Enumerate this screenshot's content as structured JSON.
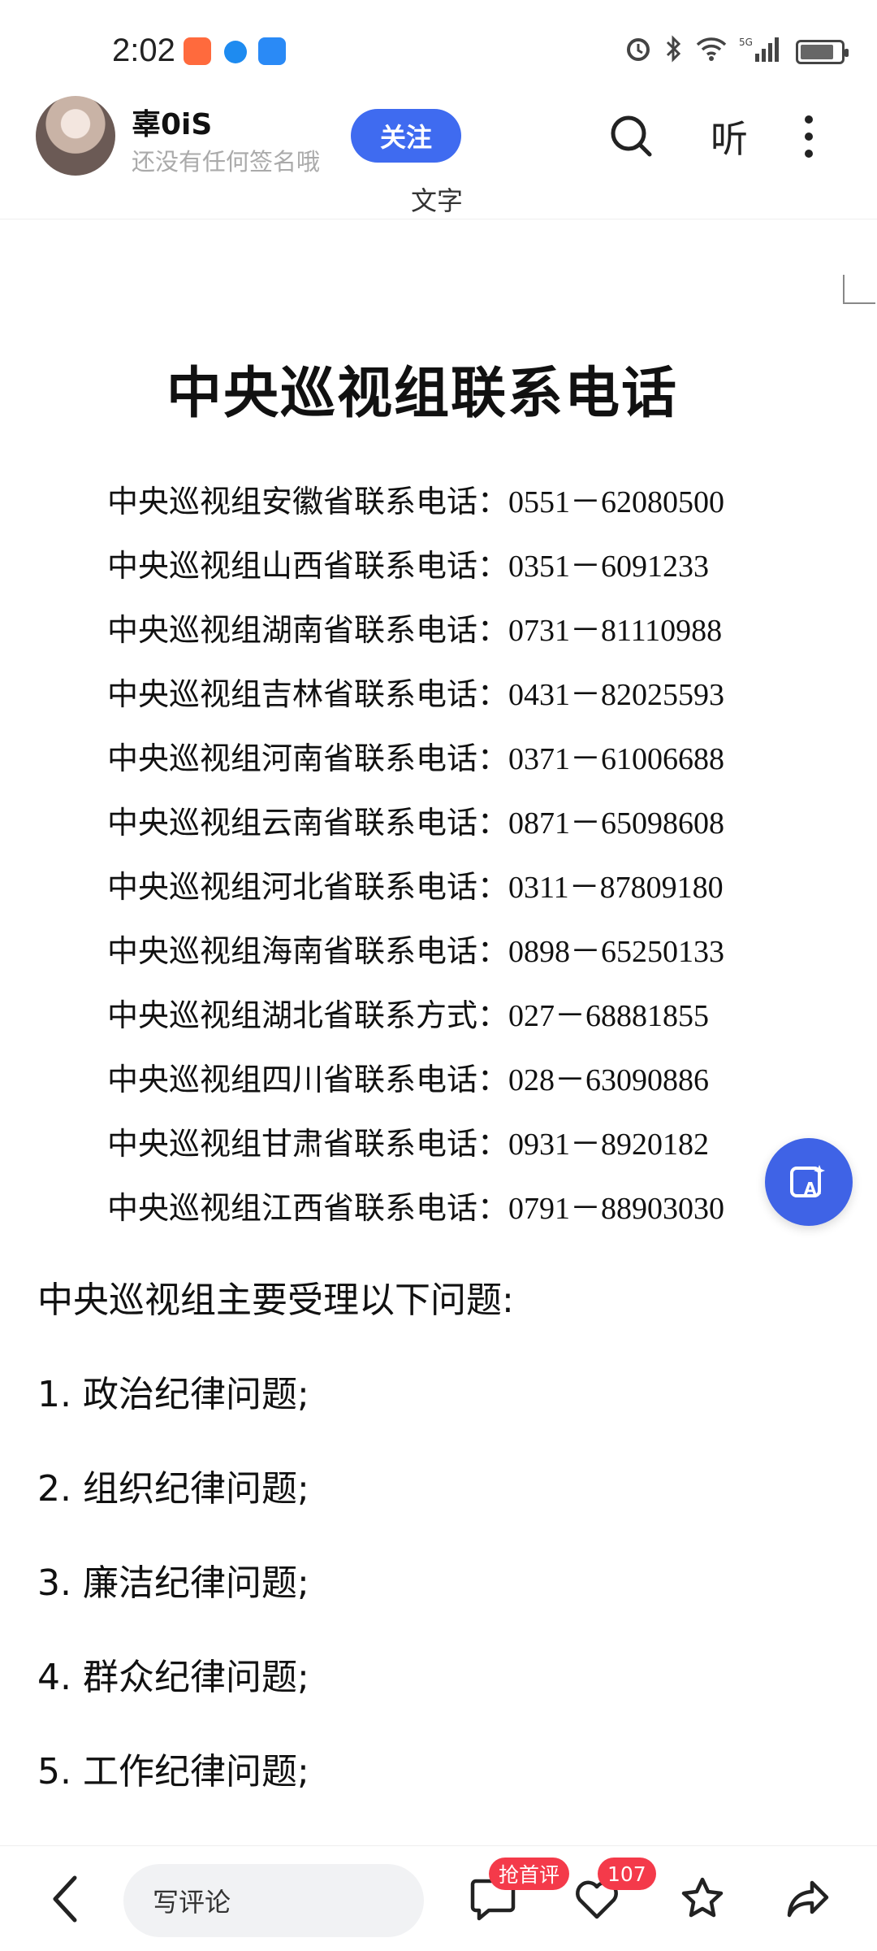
{
  "status_bar": {
    "time": "2:02",
    "app_icons": [
      "notification-app-icon",
      "browser-icon",
      "cloud-icon"
    ],
    "right_icons": [
      "alarm-icon",
      "bluetooth-icon",
      "wifi-icon",
      "5g-signal-icon",
      "battery-charging-icon"
    ]
  },
  "header": {
    "author_name": "辜0iS",
    "author_signature": "还没有任何签名哦",
    "follow_label": "关注",
    "listen_label": "听",
    "doc_type": "文字"
  },
  "document": {
    "title": "中央巡视组联系电话",
    "phones": [
      "中央巡视组安徽省联系电话：0551－62080500",
      "中央巡视组山西省联系电话：0351－6091233",
      "中央巡视组湖南省联系电话：0731－81110988",
      "中央巡视组吉林省联系电话：0431－82025593",
      "中央巡视组河南省联系电话：0371－61006688",
      "中央巡视组云南省联系电话：0871－65098608",
      "中央巡视组河北省联系电话：0311－87809180",
      "中央巡视组海南省联系电话：0898－65250133",
      "中央巡视组湖北省联系方式：027－68881855",
      "中央巡视组四川省联系电话：028－63090886",
      "中央巡视组甘肃省联系电话：0931－8920182",
      "中央巡视组江西省联系电话：0791－88903030"
    ]
  },
  "body": {
    "paragraphs": [
      "中央巡视组主要受理以下问题:",
      "1. 政治纪律问题;",
      "2. 组织纪律问题;",
      "3. 廉洁纪律问题;",
      "4. 群众纪律问题;",
      "5. 工作纪律问题;"
    ]
  },
  "bottom_bar": {
    "comment_placeholder": "写评论",
    "comment_badge": "抢首评",
    "like_count": "107"
  },
  "colors": {
    "accent": "#3f6bf0",
    "badge": "#f43a4a",
    "ai_fab": "#3f63e6"
  }
}
